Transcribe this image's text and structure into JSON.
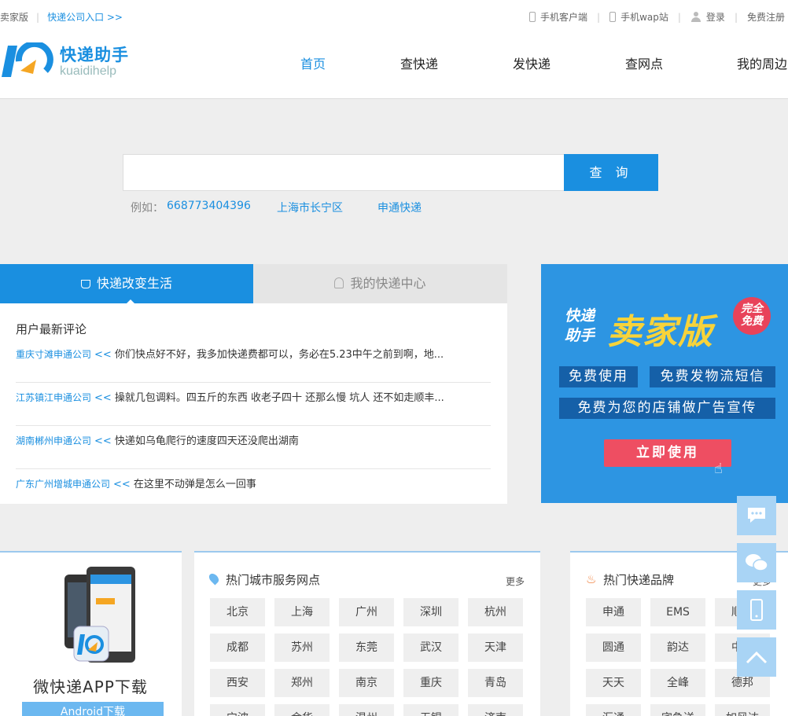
{
  "topbar": {
    "seller": "卖家版",
    "company_entry": "快递公司入口 >>",
    "mobile_client": "手机客户端",
    "mobile_wap": "手机wap站",
    "login": "登录",
    "register": "免费注册"
  },
  "logo": {
    "cn": "快递助手",
    "en": "kuaidihelp"
  },
  "nav": [
    "首页",
    "查快递",
    "发快递",
    "查网点",
    "我的周边"
  ],
  "search": {
    "placeholder": "",
    "button": "查 询"
  },
  "examples": {
    "label": "例如：",
    "items": [
      "668773404396",
      "上海市长宁区",
      "申通快递"
    ]
  },
  "tabs": {
    "active": "快递改变生活",
    "inactive": "我的快递中心"
  },
  "comments": {
    "title": "用户最新评论",
    "items": [
      {
        "company": "重庆寸滩申通公司",
        "arrow": "<<",
        "text": "你们快点好不好，我多加快递费都可以，务必在5.23中午之前到啊，地..."
      },
      {
        "company": "江苏镇江申通公司",
        "arrow": "<<",
        "text": "操就几包调料。四五斤的东西 收老子四十 还那么慢 坑人 还不如走顺丰..."
      },
      {
        "company": "湖南郴州申通公司",
        "arrow": "<<",
        "text": "快递如乌龟爬行的速度四天还没爬出湖南"
      },
      {
        "company": "广东广州增城申通公司",
        "arrow": "<<",
        "text": "在这里不动弹是怎么一回事"
      }
    ]
  },
  "banner": {
    "brand_line1": "快递",
    "brand_line2": "助手",
    "headline": "卖家版",
    "badge_line1": "完全",
    "badge_line2": "免费",
    "chip1": "免费使用",
    "chip2": "免费发物流短信",
    "chip3": "免费为您的店铺做广告宣传",
    "cta": "立即使用"
  },
  "app": {
    "title": "微快递APP下载",
    "button": "Android下载"
  },
  "cities": {
    "title": "热门城市服务网点",
    "more": "更多",
    "items": [
      "北京",
      "上海",
      "广州",
      "深圳",
      "杭州",
      "成都",
      "苏州",
      "东莞",
      "武汉",
      "天津",
      "西安",
      "郑州",
      "南京",
      "重庆",
      "青岛",
      "宁波",
      "金华",
      "温州",
      "无锡",
      "济南"
    ]
  },
  "brands": {
    "title": "热门快递品牌",
    "more": "更多",
    "items": [
      "申通",
      "EMS",
      "顺丰",
      "圆通",
      "韵达",
      "中通",
      "天天",
      "全峰",
      "德邦",
      "汇通",
      "宅急送",
      "如风达"
    ]
  },
  "colors": {
    "accent": "#1a8fe0",
    "banner_bg": "#2d95e2",
    "cta": "#ee4e62",
    "headline": "#f7d33a"
  },
  "side_tools": [
    "chat-icon",
    "wechat-icon",
    "mobile-icon",
    "back-to-top-icon"
  ]
}
